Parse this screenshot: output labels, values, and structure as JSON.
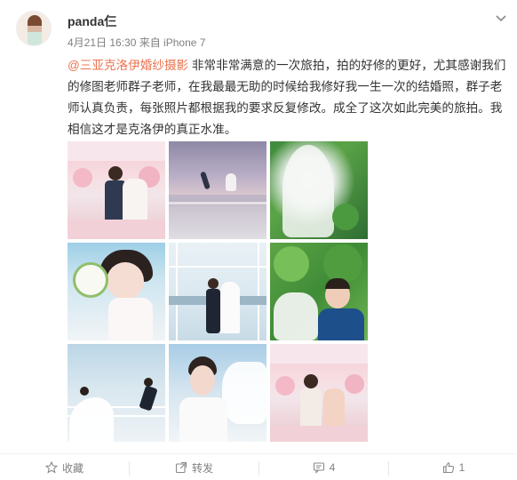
{
  "post": {
    "username": "panda仨",
    "meta": "4月21日 16:30 来自 iPhone 7",
    "mention": "@三亚克洛伊婚纱摄影",
    "body": " 非常非常满意的一次旅拍，拍的好修的更好，尤其感谢我们的修图老师群子老师，在我最最无助的时候给我修好我一生一次的结婚照，群子老师认真负责，每张照片都根据我的要求反复修改。成全了这次如此完美的旅拍。我相信这才是克洛伊的真正水准。"
  },
  "photos": [
    {
      "name": "photo-couple-pink-room"
    },
    {
      "name": "photo-jumping-beach-sunset"
    },
    {
      "name": "photo-veil-greenery"
    },
    {
      "name": "photo-bride-bouquet"
    },
    {
      "name": "photo-couple-glass-pavilion"
    },
    {
      "name": "photo-couple-plants"
    },
    {
      "name": "photo-jumping-pier"
    },
    {
      "name": "photo-bride-portrait-veil"
    },
    {
      "name": "photo-couple-pink-room-2"
    }
  ],
  "actions": {
    "favorite_label": "收藏",
    "forward_label": "转发",
    "comment_count": "4",
    "like_count": "1"
  },
  "icons": {
    "favorite": "star-icon",
    "forward": "share-arrow-icon",
    "comment": "comment-bubble-icon",
    "like": "thumbs-up-icon",
    "menu": "chevron-down-icon"
  },
  "colors": {
    "mention": "#eb7350",
    "meta": "#808080",
    "text": "#333333"
  }
}
